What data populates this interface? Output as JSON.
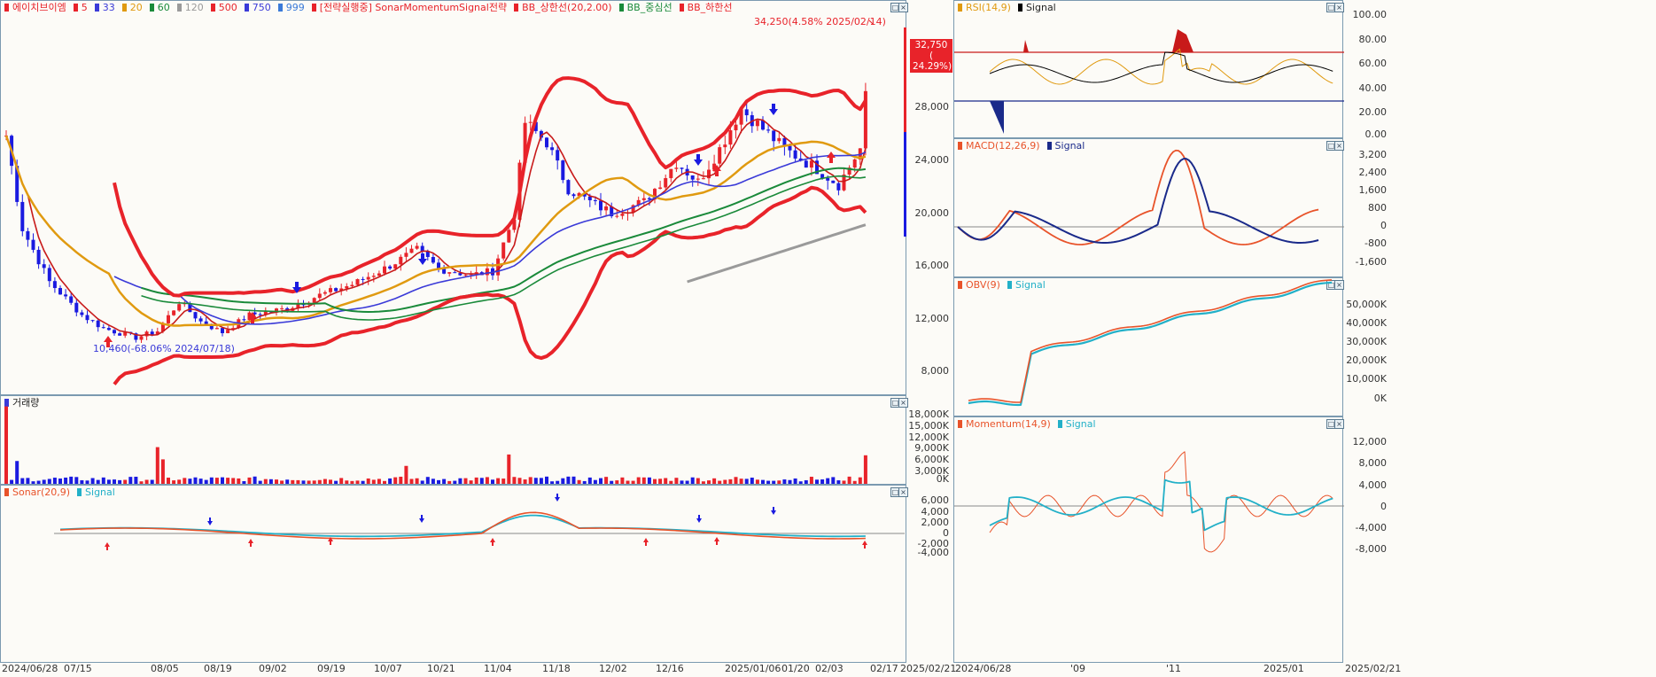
{
  "main": {
    "legend": [
      {
        "text": "에이치브이엠",
        "color": "#e8232a"
      },
      {
        "text": "5",
        "color": "#e8232a"
      },
      {
        "text": "33",
        "color": "#3a3ad8"
      },
      {
        "text": "20",
        "color": "#e09a10"
      },
      {
        "text": "60",
        "color": "#1a8a3a"
      },
      {
        "text": "120",
        "color": "#9a9a9a"
      },
      {
        "text": "500",
        "color": "#e8232a"
      },
      {
        "text": "750",
        "color": "#3a3ad8"
      },
      {
        "text": "999",
        "color": "#3a7ad8"
      },
      {
        "text": "[전략실행중] SonarMomentumSignal전략",
        "color": "#e8232a"
      },
      {
        "text": "BB_상한선(20,2.00)",
        "color": "#e8232a"
      },
      {
        "text": "BB_중심선",
        "color": "#1a8a3a"
      },
      {
        "text": "BB_하한선",
        "color": "#e8232a"
      }
    ],
    "y_ticks": [
      "28,000",
      "24,000",
      "20,000",
      "16,000",
      "12,000",
      "8,000"
    ],
    "high_annotation": "34,250(4.58% 2025/02/14)",
    "low_annotation": "10,460(-68.06% 2024/07/18)",
    "current_price": "32,750",
    "current_change": "( 24.29%)"
  },
  "volume": {
    "legend": "거래량",
    "y_ticks": [
      "18,000K",
      "15,000K",
      "12,000K",
      "9,000K",
      "6,000K",
      "3,000K",
      "0K"
    ]
  },
  "sonar": {
    "legend_a": "Sonar(20,9)",
    "legend_b": "Signal",
    "y_ticks": [
      "6,000",
      "4,000",
      "2,000",
      "0",
      "-2,000",
      "-4,000"
    ]
  },
  "dates_main": [
    "2024/06/28",
    "07/15",
    "08/05",
    "08/19",
    "09/02",
    "09/19",
    "10/07",
    "10/21",
    "11/04",
    "11/18",
    "12/02",
    "12/16",
    "2025/01/06",
    "01/20",
    "02/03",
    "02/17",
    "2025/02/21"
  ],
  "rsi": {
    "legend_a": "RSI(14,9)",
    "legend_b": "Signal",
    "y_ticks": [
      "100.00",
      "80.00",
      "60.00",
      "40.00",
      "20.00",
      "0.00"
    ]
  },
  "macd": {
    "legend_a": "MACD(12,26,9)",
    "legend_b": "Signal",
    "y_ticks": [
      "3,200",
      "2,400",
      "1,600",
      "800",
      "0",
      "-800",
      "-1,600"
    ]
  },
  "obv": {
    "legend_a": "OBV(9)",
    "legend_b": "Signal",
    "y_ticks": [
      "50,000K",
      "40,000K",
      "30,000K",
      "20,000K",
      "10,000K",
      "0K"
    ]
  },
  "momentum": {
    "legend_a": "Momentum(14,9)",
    "legend_b": "Signal",
    "y_ticks": [
      "12,000",
      "8,000",
      "4,000",
      "0",
      "-4,000",
      "-8,000"
    ]
  },
  "dates_right": [
    "2024/06/28",
    "'09",
    "'11",
    "2025/01",
    "2025/02/21"
  ],
  "colors": {
    "up": "#e8232a",
    "down": "#1a1ae0",
    "bb": "#e8232a",
    "ma20": "#e09a10",
    "ma60": "#1a8a3a",
    "ma33": "#3a3ad8",
    "ma120": "#9a9a9a",
    "signal": "#22b0c8"
  }
}
